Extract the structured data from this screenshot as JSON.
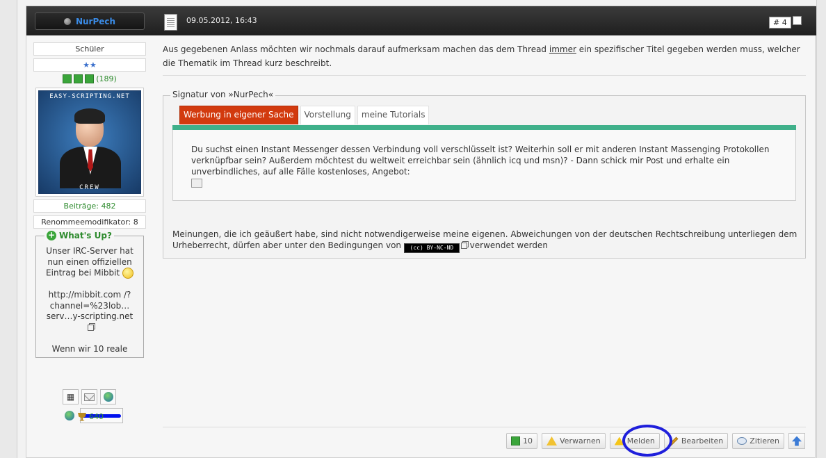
{
  "post": {
    "username": "NurPech",
    "date": "09.05.2012, 16:43",
    "number": "# 4"
  },
  "sidebar": {
    "rank": "Schüler",
    "rep_count": "(189)",
    "avatar_top_text": "EASY-SCRIPTING.NET",
    "avatar_bottom_text": "CREW",
    "posts": "Beiträge: 482",
    "reputation_mod": "Renommeemodifikator: 8",
    "whatsup_title": "What's Up?",
    "whatsup_line1": "Unser IRC-Server hat nun einen offiziellen Eintrag bei Mibbit",
    "whatsup_line2": "http://mibbit.com /?channel=%23lob… serv…y-scripting.net",
    "whatsup_line3": "Wenn wir 10 reale",
    "trophy_points": "640"
  },
  "message": {
    "part1": "Aus gegebenen Anlass möchten wir nochmals darauf aufmerksam machen das dem Thread ",
    "underlined": "immer",
    "part2": " ein spezifischer Titel gegeben werden muss, welcher die Thematik im Thread kurz beschreibt."
  },
  "signature": {
    "legend": "Signatur von »NurPech«",
    "tabs": [
      {
        "label": "Werbung in eigener Sache"
      },
      {
        "label": "Vorstellung"
      },
      {
        "label": "meine Tutorials"
      }
    ],
    "panel_text": "Du suchst einen Instant Messenger dessen Verbindung voll verschlüsselt ist? Weiterhin soll er mit anderen Instant Massenging Protokollen verknüpfbar sein? Außerdem möchtest du weltweit erreichbar sein (ähnlich icq und msn)? - Dann schick mir Post und erhalte ein unverbindliches, auf alle Fälle kostenloses, Angebot:",
    "footnote_part1": "Meinungen, die ich geäußert habe, sind nicht notwendigerweise meine eigenen. Abweichungen von der deutschen Rechtschreibung unterliegen dem Urheberrecht, dürfen aber unter den Bedingungen von ",
    "cc_badge": "(cc) BY-NC-ND",
    "footnote_part2": " verwendet werden"
  },
  "actions": {
    "like_count": "10",
    "warn": "Verwarnen",
    "report": "Melden",
    "edit": "Bearbeiten",
    "quote": "Zitieren"
  },
  "colors": {
    "active_tab": "#d23a0e",
    "tab_bar": "#3fb08a",
    "highlight_annotation": "#1f1fdb",
    "username": "#3a8be6"
  }
}
